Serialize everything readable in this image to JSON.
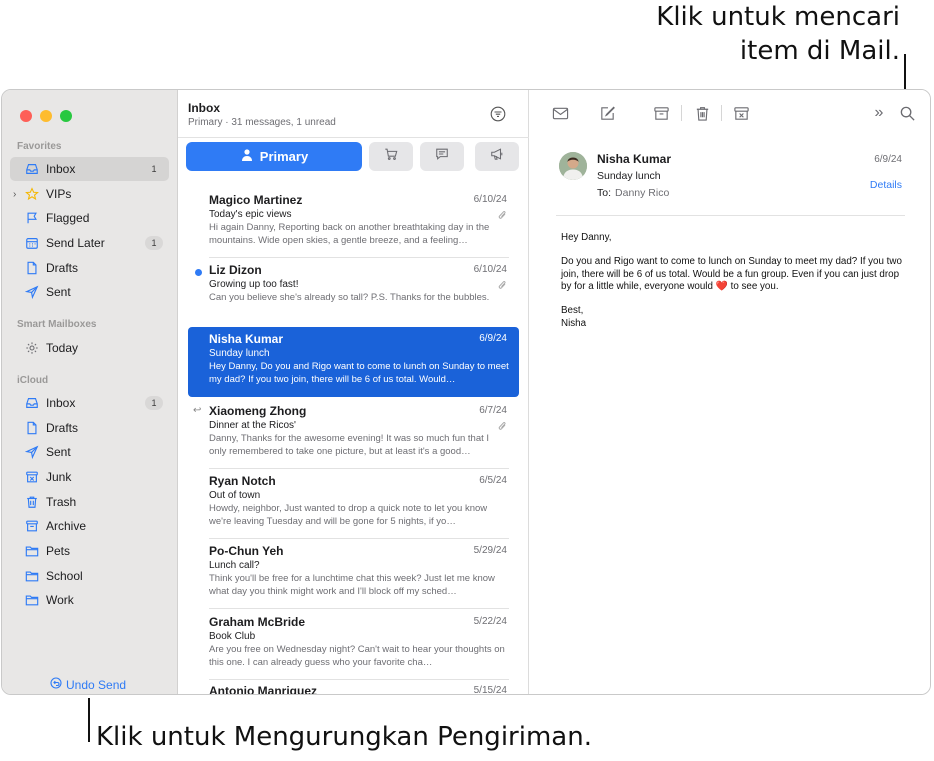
{
  "callouts": {
    "search_line1": "Klik untuk mencari",
    "search_line2": "item di Mail.",
    "undo": "Klik untuk Mengurungkan Pengiriman."
  },
  "sidebar": {
    "favorites_label": "Favorites",
    "favorites": [
      {
        "label": "Inbox",
        "icon": "tray-icon",
        "badge": "1"
      },
      {
        "label": "VIPs",
        "icon": "star-icon"
      },
      {
        "label": "Flagged",
        "icon": "flag-icon"
      },
      {
        "label": "Send Later",
        "icon": "calendar-icon",
        "badge": "1"
      },
      {
        "label": "Drafts",
        "icon": "doc-icon"
      },
      {
        "label": "Sent",
        "icon": "paperplane-icon"
      }
    ],
    "smart_label": "Smart Mailboxes",
    "smart": [
      {
        "label": "Today",
        "icon": "gear-icon"
      }
    ],
    "icloud_label": "iCloud",
    "icloud": [
      {
        "label": "Inbox",
        "icon": "tray-icon",
        "badge": "1"
      },
      {
        "label": "Drafts",
        "icon": "doc-icon"
      },
      {
        "label": "Sent",
        "icon": "paperplane-icon"
      },
      {
        "label": "Junk",
        "icon": "junk-icon"
      },
      {
        "label": "Trash",
        "icon": "trash-icon"
      },
      {
        "label": "Archive",
        "icon": "archive-icon"
      },
      {
        "label": "Pets",
        "icon": "folder-icon"
      },
      {
        "label": "School",
        "icon": "folder-icon"
      },
      {
        "label": "Work",
        "icon": "folder-icon"
      }
    ],
    "undo_send": "Undo Send"
  },
  "list": {
    "title": "Inbox",
    "subtitle": "Primary · 31 messages, 1 unread",
    "primary_tab": "Primary",
    "messages": [
      {
        "from": "Magico Martinez",
        "date": "6/10/24",
        "subject": "Today's epic views",
        "preview": "Hi again Danny, Reporting back on another breathtaking day in the mountains. Wide open skies, a gentle breeze, and a feeling…"
      },
      {
        "from": "Liz Dizon",
        "date": "6/10/24",
        "subject": "Growing up too fast!",
        "preview": "Can you believe she's already so tall? P.S. Thanks for the bubbles."
      },
      {
        "from": "Nisha Kumar",
        "date": "6/9/24",
        "subject": "Sunday lunch",
        "preview": "Hey Danny, Do you and Rigo want to come to lunch on Sunday to meet my dad? If you two join, there will be 6 of us total. Would…"
      },
      {
        "from": "Xiaomeng Zhong",
        "date": "6/7/24",
        "subject": "Dinner at the Ricos'",
        "preview": "Danny, Thanks for the awesome evening! It was so much fun that I only remembered to take one picture, but at least it's a good…"
      },
      {
        "from": "Ryan Notch",
        "date": "6/5/24",
        "subject": "Out of town",
        "preview": "Howdy, neighbor, Just wanted to drop a quick note to let you know we're leaving Tuesday and will be gone for 5 nights, if yo…"
      },
      {
        "from": "Po-Chun Yeh",
        "date": "5/29/24",
        "subject": "Lunch call?",
        "preview": "Think you'll be free for a lunchtime chat this week? Just let me know what day you think might work and I'll block off my sched…"
      },
      {
        "from": "Graham McBride",
        "date": "5/22/24",
        "subject": "Book Club",
        "preview": "Are you free on Wednesday night? Can't wait to hear your thoughts on this one. I can already guess who your favorite cha…"
      },
      {
        "from": "Antonio Manriquez",
        "date": "5/15/24",
        "subject": "",
        "preview": ""
      }
    ]
  },
  "reader": {
    "from": "Nisha Kumar",
    "date": "6/9/24",
    "subject": "Sunday lunch",
    "to_label": "To:",
    "to_name": "Danny Rico",
    "details": "Details",
    "greeting": "Hey Danny,",
    "body_main": "Do you and Rigo want to come to lunch on Sunday to meet my dad? If you two join, there will be 6 of us total. Would be a fun group. Even if you can just drop by for a little while, everyone would",
    "heart": "❤️",
    "body_end": "to see you.",
    "signoff": "Best,",
    "signature": "Nisha"
  }
}
